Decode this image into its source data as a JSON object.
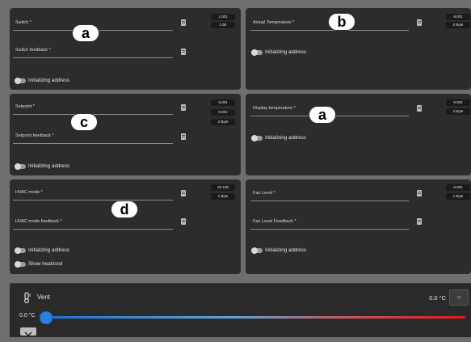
{
  "panel1": {
    "field1": "Switch *",
    "field2": "Switch feedback *",
    "tag1": "1.001",
    "tag2": "1 Bit",
    "toggle": "Initializing address"
  },
  "panel2": {
    "field1": "Actual Temperature *",
    "tag1": "9.001",
    "tag2": "2 Byte",
    "toggle": "Initializing address"
  },
  "panel3": {
    "field1": "Setpoint *",
    "field2": "Setpoint feedback *",
    "tag1": "9.001",
    "tag2": "9.002",
    "tag3": "2 Byte",
    "toggle": "Initializing address"
  },
  "panel4": {
    "field1": "Display temperature *",
    "tag1": "9.001",
    "tag2": "2 Byte",
    "toggle": "Initializing address"
  },
  "panel5": {
    "field1": "HVAC mode *",
    "field2": "HVAC mode feedback *",
    "tag1": "20.105",
    "tag2": "1 Byte",
    "toggle1": "Initializing address",
    "toggle2": "Show heat/cool"
  },
  "panel6": {
    "field1": "Fan Level *",
    "field2": "Fan Level Feedback *",
    "tag1": "5.001",
    "tag2": "1 Byte",
    "toggle": "Initializing address"
  },
  "markers": {
    "m1": "a",
    "m2": "b",
    "m3": "c",
    "m4": "a",
    "m5": "d"
  },
  "vent": {
    "title": "Vent",
    "readout": "0.0 °C",
    "slider_label": "0.0 °C",
    "slider_value": 0,
    "power_symbol": "○"
  },
  "colors": {
    "panel": "#2c2c2c",
    "slider_start": "#1e6fd9",
    "slider_end": "#e3191c"
  }
}
